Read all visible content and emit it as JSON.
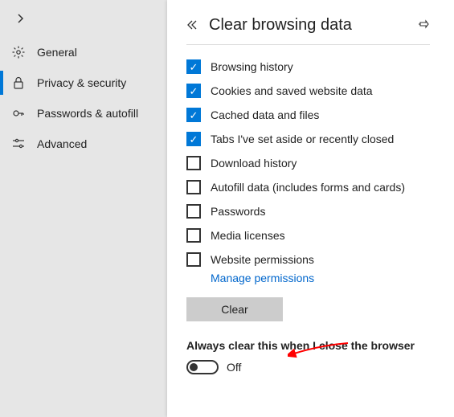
{
  "sidebar": {
    "items": [
      {
        "label": "General"
      },
      {
        "label": "Privacy & security"
      },
      {
        "label": "Passwords & autofill"
      },
      {
        "label": "Advanced"
      }
    ]
  },
  "panel": {
    "title": "Clear browsing data",
    "options": [
      {
        "label": "Browsing history",
        "checked": true
      },
      {
        "label": "Cookies and saved website data",
        "checked": true
      },
      {
        "label": "Cached data and files",
        "checked": true
      },
      {
        "label": "Tabs I've set aside or recently closed",
        "checked": true
      },
      {
        "label": "Download history",
        "checked": false
      },
      {
        "label": "Autofill data (includes forms and cards)",
        "checked": false
      },
      {
        "label": "Passwords",
        "checked": false
      },
      {
        "label": "Media licenses",
        "checked": false
      },
      {
        "label": "Website permissions",
        "checked": false
      }
    ],
    "manage_link": "Manage permissions",
    "clear_button": "Clear",
    "always_clear_label": "Always clear this when I close the browser",
    "toggle_state": "Off"
  }
}
